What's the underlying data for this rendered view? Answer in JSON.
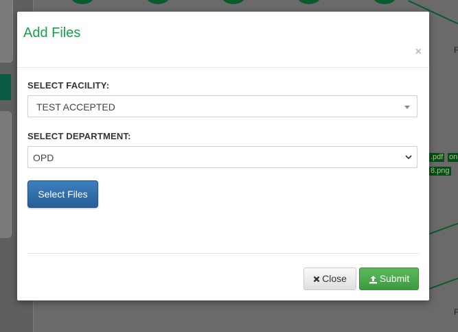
{
  "modal": {
    "title": "Add Files",
    "close_glyph": "×",
    "facility_label": "SELECT FACILITY:",
    "facility_value": "TEST ACCEPTED",
    "department_label": "SELECT DEPARTMENT:",
    "department_value": "OPD",
    "select_files_label": "Select Files",
    "close_label": "Close",
    "submit_label": "Submit"
  },
  "background": {
    "tags": [
      ".pdf",
      "on",
      "8.png"
    ],
    "letters": [
      "F",
      "F"
    ]
  },
  "icons": {
    "close_icon": "times-icon",
    "submit_icon": "upload-icon",
    "select_caret": "caret-down-icon",
    "department_chevron": "chevron-down-icon"
  },
  "colors": {
    "title": "#15a050",
    "primary_button": "#337ab7",
    "success_button": "#4cae4c",
    "overlay_background": "#5f5f5f"
  }
}
